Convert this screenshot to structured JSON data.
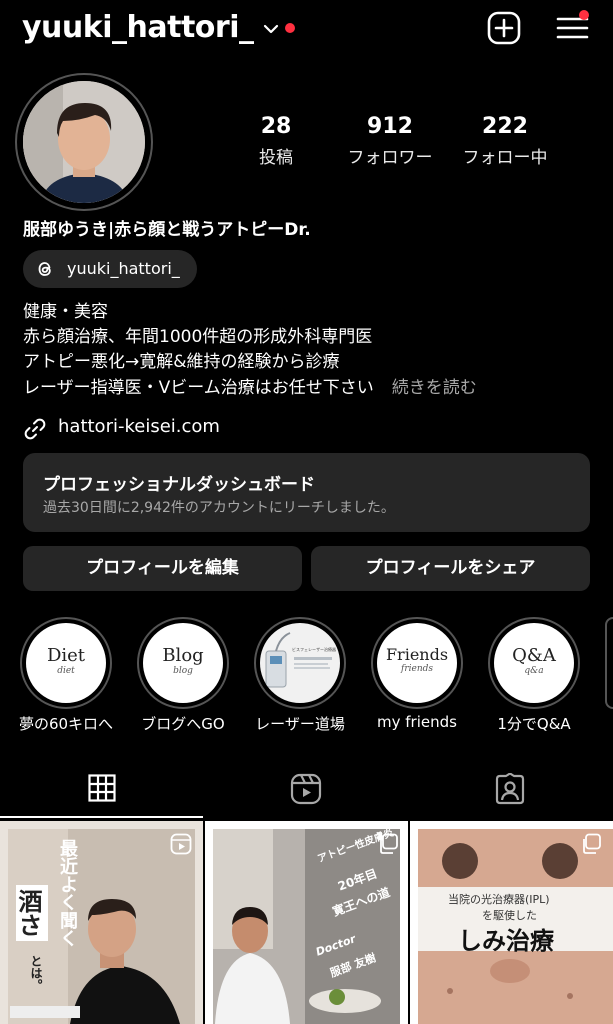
{
  "header": {
    "username": "yuuki_hattori_"
  },
  "stats": [
    {
      "value": "28",
      "label": "投稿"
    },
    {
      "value": "912",
      "label": "フォロワー"
    },
    {
      "value": "222",
      "label": "フォロー中"
    }
  ],
  "profile": {
    "display_name": "服部ゆうき|赤ら顔と戦うアトピーDr.",
    "threads_handle": "yuuki_hattori_",
    "bio_lines": [
      "健康・美容",
      "赤ら顔治療、年間1000件超の形成外科専門医",
      "アトピー悪化→寛解&維持の経験から診療",
      "レーザー指導医・Vビーム治療はお任せ下さい"
    ],
    "more_label": "続きを読む",
    "link": "hattori-keisei.com"
  },
  "dashboard": {
    "title": "プロフェッショナルダッシュボード",
    "subtitle": "過去30日間に2,942件のアカウントにリーチしました。"
  },
  "buttons": {
    "edit_profile": "プロフィールを編集",
    "share_profile": "プロフィールをシェア"
  },
  "highlights": [
    {
      "cover_main": "Diet",
      "cover_sub": "diet",
      "label": "夢の60キロへ"
    },
    {
      "cover_main": "Blog",
      "cover_sub": "blog",
      "label": "ブログへGO"
    },
    {
      "cover_main": "ビスフェレーザー治療器",
      "cover_sub": "",
      "label": "レーザー道場"
    },
    {
      "cover_main": "Friends",
      "cover_sub": "friends",
      "label": "my friends"
    },
    {
      "cover_main": "Q&A",
      "cover_sub": "q&a",
      "label": "1分でQ&A"
    }
  ],
  "posts": [
    {
      "text_main": "酒さ",
      "text_vertical": "最近よく聞く",
      "text_small": "とは。"
    },
    {
      "text_top": "アトピー性皮膚炎",
      "text_mid": "20年目",
      "text_mid2": "寛王への道",
      "text_sig": "Doctor",
      "text_sig2": "服部 友樹"
    },
    {
      "text_top": "当院の光治療器(IPL)",
      "text_top2": "を駆使した",
      "text_main": "しみ治療"
    }
  ],
  "colors": {
    "background": "#000000",
    "card": "#262626",
    "notification": "#ff3040",
    "muted_text": "#a8a8a8"
  },
  "icons": [
    "chevron-down-icon",
    "plus-square-icon",
    "hamburger-menu-icon",
    "threads-icon",
    "link-icon",
    "grid-icon",
    "reels-icon",
    "tagged-icon"
  ]
}
